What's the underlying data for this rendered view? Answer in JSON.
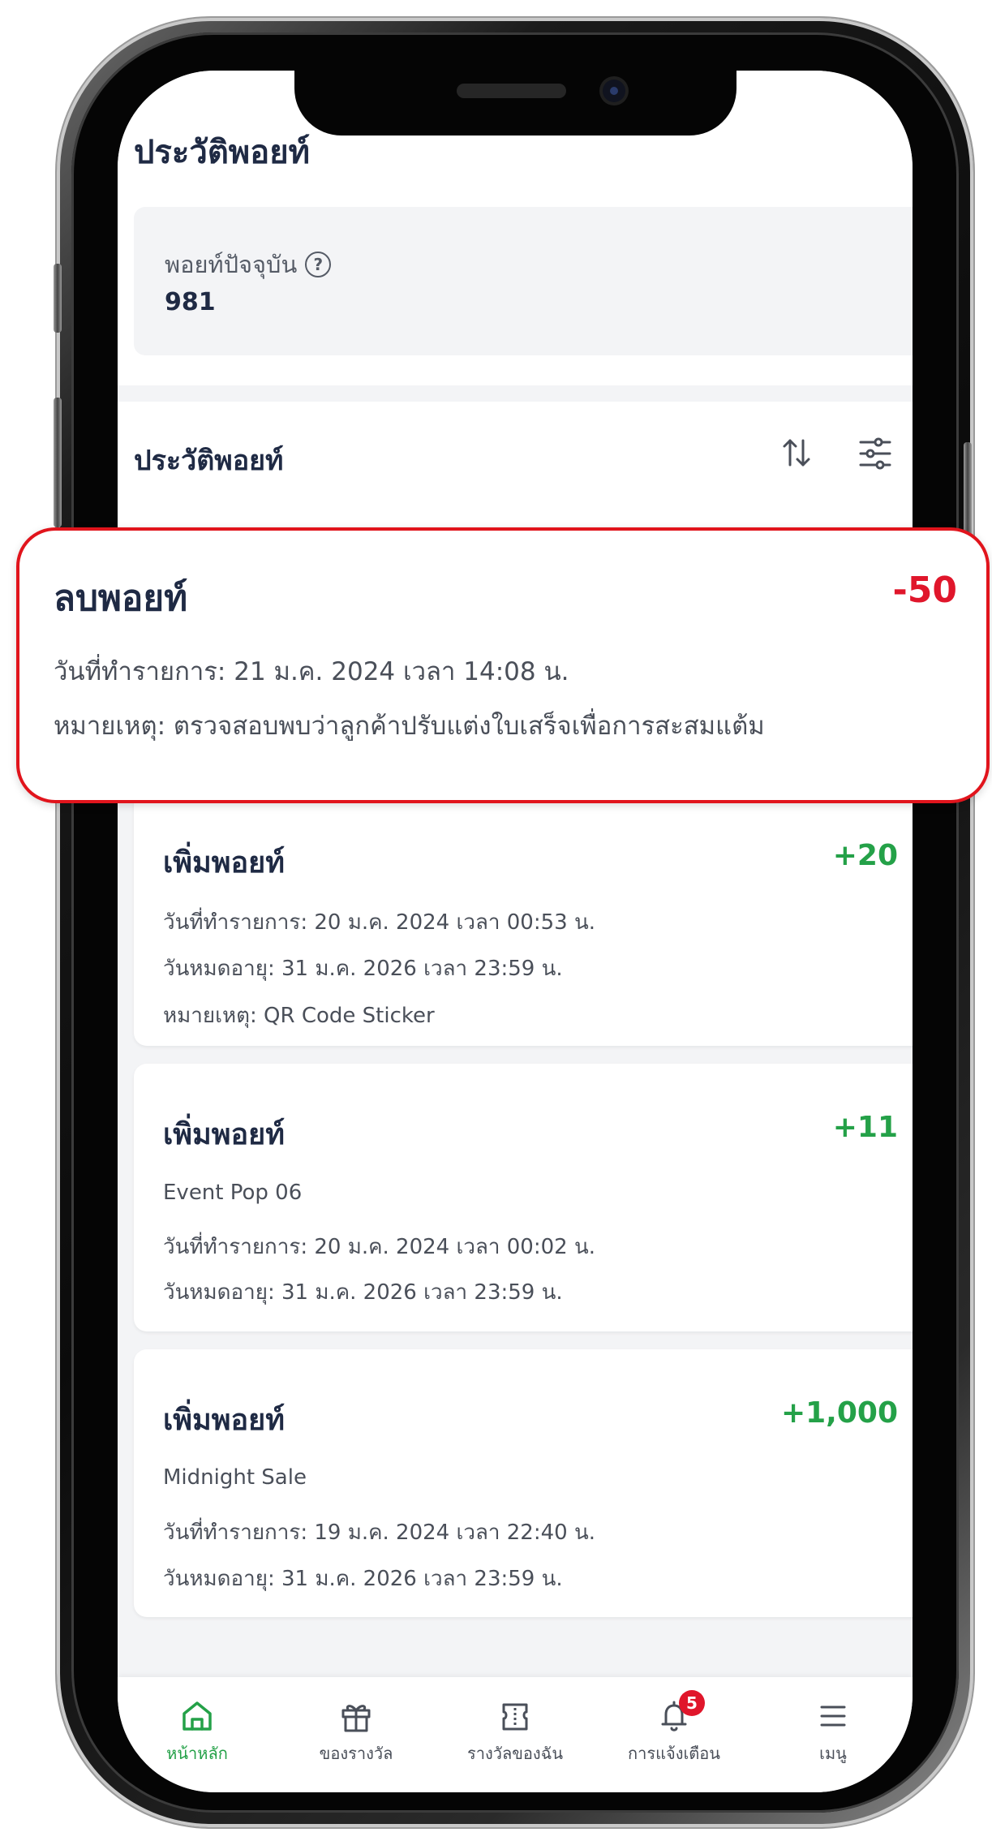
{
  "page": {
    "title": "ประวัติพอยท์"
  },
  "points_summary": {
    "label": "พอยท์ปัจจุบัน",
    "help_icon": "question-circle-icon",
    "value": "981"
  },
  "history": {
    "title": "ประวัติพอยท์",
    "sort_icon": "sort-arrows-icon",
    "filter_icon": "sliders-icon"
  },
  "highlighted_transaction": {
    "type": "ลบพอยท์",
    "amount": "-50",
    "amount_color": "#e0162b",
    "date": "วันที่ทำรายการ: 21 ม.ค. 2024 เวลา 14:08 น.",
    "note": "หมายเหตุ: ตรวจสอบพบว่าลูกค้าปรับแต่งใบเสร็จเพื่อการสะสมแต้ม",
    "highlight_color": "#e1141c"
  },
  "transactions": [
    {
      "type": "เพิ่มพอยท์",
      "amount": "+20",
      "lines": [
        "วันที่ทำรายการ: 20 ม.ค. 2024 เวลา 00:53 น.",
        "วันหมดอายุ: 31 ม.ค. 2026 เวลา 23:59 น.",
        "หมายเหตุ: QR Code Sticker"
      ]
    },
    {
      "type": "เพิ่มพอยท์",
      "amount": "+11",
      "lines": [
        "Event Pop 06",
        "วันที่ทำรายการ: 20 ม.ค. 2024 เวลา 00:02 น.",
        "วันหมดอายุ: 31 ม.ค. 2026 เวลา 23:59 น."
      ]
    },
    {
      "type": "เพิ่มพอยท์",
      "amount": "+1,000",
      "lines": [
        "Midnight Sale",
        "วันที่ทำรายการ: 19 ม.ค. 2024 เวลา 22:40 น.",
        "วันหมดอายุ: 31 ม.ค. 2026 เวลา 23:59 น."
      ]
    }
  ],
  "bottom_nav": [
    {
      "label": "หน้าหลัก",
      "icon": "home-icon",
      "active": true
    },
    {
      "label": "ของรางวัล",
      "icon": "gift-icon",
      "active": false
    },
    {
      "label": "รางวัลของฉัน",
      "icon": "ticket-icon",
      "active": false
    },
    {
      "label": "การแจ้งเตือน",
      "icon": "bell-icon",
      "active": false,
      "badge": "5"
    },
    {
      "label": "เมนู",
      "icon": "menu-icon",
      "active": false
    }
  ],
  "colors": {
    "positive": "#24a148",
    "negative": "#e0162b",
    "text_dark": "#1f2a44"
  }
}
